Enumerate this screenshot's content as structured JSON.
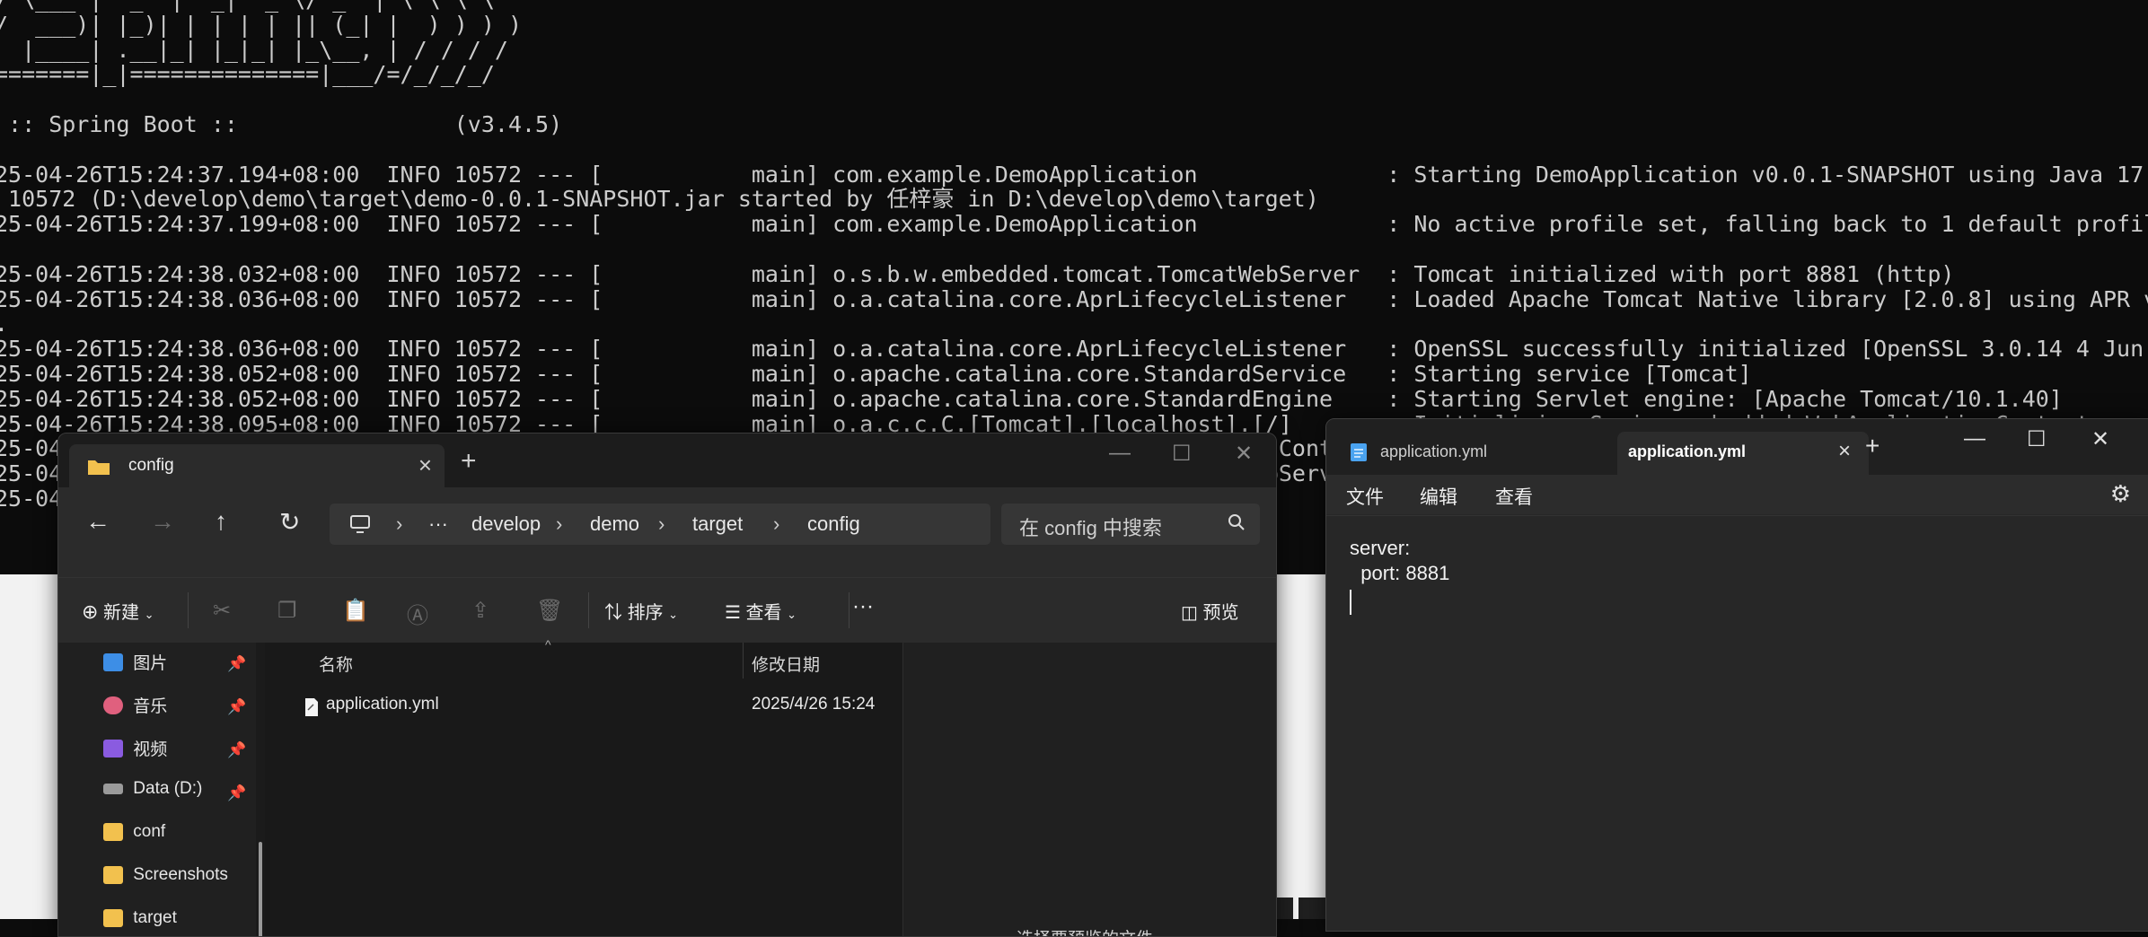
{
  "terminal": {
    "text": "/ \\___ |  _  |  _|  _ \\/ _` | \\ \\ \\ \\\n/  ___)| |_)| | | | | || (_| |  ) ) ) )\n  |____| .__|_| |_|_| |_\\__, | / / / /\n=======|_|==============|___/=/_/_/_/\n\n :: Spring Boot ::                (v3.4.5)\n\n25-04-26T15:24:37.194+08:00  INFO 10572 --- [           main] com.example.DemoApplication              : Starting DemoApplication v0.0.1-SNAPSHOT using Java 17.0.12 with P\n 10572 (D:\\develop\\demo\\target\\demo-0.0.1-SNAPSHOT.jar started by 任梓豪 in D:\\develop\\demo\\target)\n25-04-26T15:24:37.199+08:00  INFO 10572 --- [           main] com.example.DemoApplication              : No active profile set, falling back to 1 default profile: \"default\n\n25-04-26T15:24:38.032+08:00  INFO 10572 --- [           main] o.s.b.w.embedded.tomcat.TomcatWebServer  : Tomcat initialized with port 8881 (http)\n25-04-26T15:24:38.036+08:00  INFO 10572 --- [           main] o.a.catalina.core.AprLifecycleListener   : Loaded Apache Tomcat Native library [2.0.8] using APR version [1.7\n.\n25-04-26T15:24:38.036+08:00  INFO 10572 --- [           main] o.a.catalina.core.AprLifecycleListener   : OpenSSL successfully initialized [OpenSSL 3.0.14 4 Jun 2024]\n25-04-26T15:24:38.052+08:00  INFO 10572 --- [           main] o.apache.catalina.core.StandardService   : Starting service [Tomcat]\n25-04-26T15:24:38.052+08:00  INFO 10572 --- [           main] o.apache.catalina.core.StandardEngine    : Starting Servlet engine: [Apache Tomcat/10.1.40]\n25-04-26T15:24:38.095+08:00  INFO 10572 --- [           main] o.a.c.c.C.[Tomcat].[localhost].[/]       : Initializing Spring embedded WebApplicationContext\n25-04-26T15:24:38.096+08:00  INFO 10572 --- [           main] w.s.c.ServletWebServerApplicationContext : Root WebApplicationContext: initialization completed in 836 ms\n25-04-26T15:24:38.516+08:00  INFO 10572 --- [           main] o.s.b.w.embedded.tomcat.TomcatWebServer  : Tomcat started on port 8881 (http) with context path '/'\n25-04-26T15:24:38.523+08:00  INFO 10572 --- [           main] com.example.DemoApplication              : Started DemoApplication in 1.679 seconds (process running for 2.1..."
  },
  "explorer": {
    "tab_title": "config",
    "new_tab": "+",
    "address": {
      "more": "···",
      "crumbs": [
        "develop",
        "demo",
        "target",
        "config"
      ]
    },
    "search_placeholder": "在 config 中搜索",
    "commands": {
      "new": "新建",
      "sort": "排序",
      "view": "查看",
      "more": "···",
      "preview": "预览"
    },
    "sidebar": [
      {
        "label": "图片",
        "pinned": true,
        "color": "#3d8ee6"
      },
      {
        "label": "音乐",
        "pinned": true,
        "color": "#e0607e"
      },
      {
        "label": "视频",
        "pinned": true,
        "color": "#8a5be0"
      },
      {
        "label": "Data (D:)",
        "pinned": true,
        "color": "#9a9a9a"
      },
      {
        "label": "conf",
        "pinned": false,
        "color": "#f2c14e"
      },
      {
        "label": "Screenshots",
        "pinned": false,
        "color": "#f2c14e"
      },
      {
        "label": "target",
        "pinned": false,
        "color": "#f2c14e"
      }
    ],
    "columns": {
      "name": "名称",
      "modified": "修改日期"
    },
    "files": [
      {
        "name": "application.yml",
        "modified": "2025/4/26 15:24"
      }
    ],
    "preview_text": "选择要预览的文件"
  },
  "notepad": {
    "tabs": [
      "application.yml",
      "application.yml"
    ],
    "new_tab": "+",
    "menu": [
      "文件",
      "编辑",
      "查看"
    ],
    "content": "server:\n  port: 8881"
  }
}
